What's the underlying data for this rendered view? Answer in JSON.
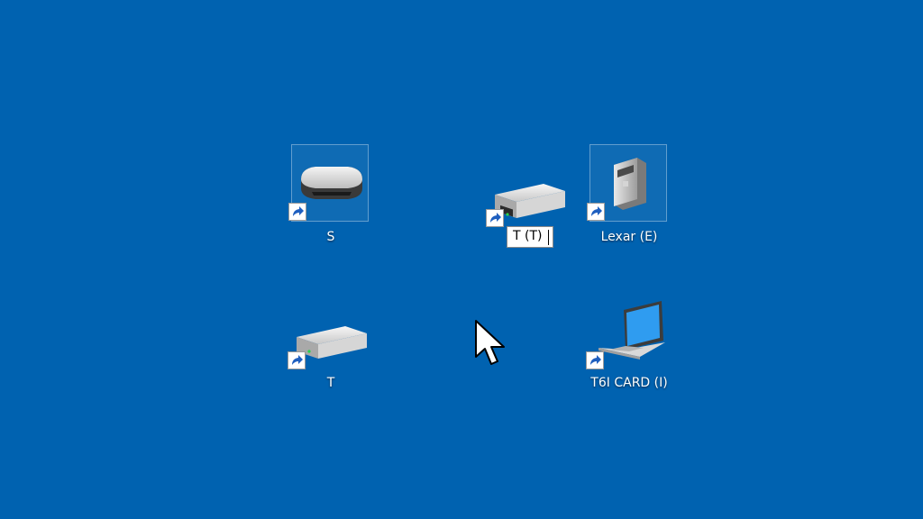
{
  "desktop": {
    "background_color": "#0062b0",
    "icons": [
      {
        "label": "S",
        "icon": "hard-drive-icon",
        "shortcut": true,
        "selected": true
      },
      {
        "label": "Lexar (E)",
        "icon": "removable-drive-icon",
        "shortcut": true,
        "selected": true
      },
      {
        "label": "T",
        "icon": "drive-icon",
        "shortcut": true,
        "selected": false
      },
      {
        "label": "T6I CARD (I)",
        "icon": "laptop-icon",
        "shortcut": true,
        "selected": false
      }
    ],
    "rename": {
      "icon": "drive-icon",
      "value": "T (T)",
      "shortcut": true
    }
  },
  "cursor": {
    "icon": "mouse-pointer-icon"
  }
}
